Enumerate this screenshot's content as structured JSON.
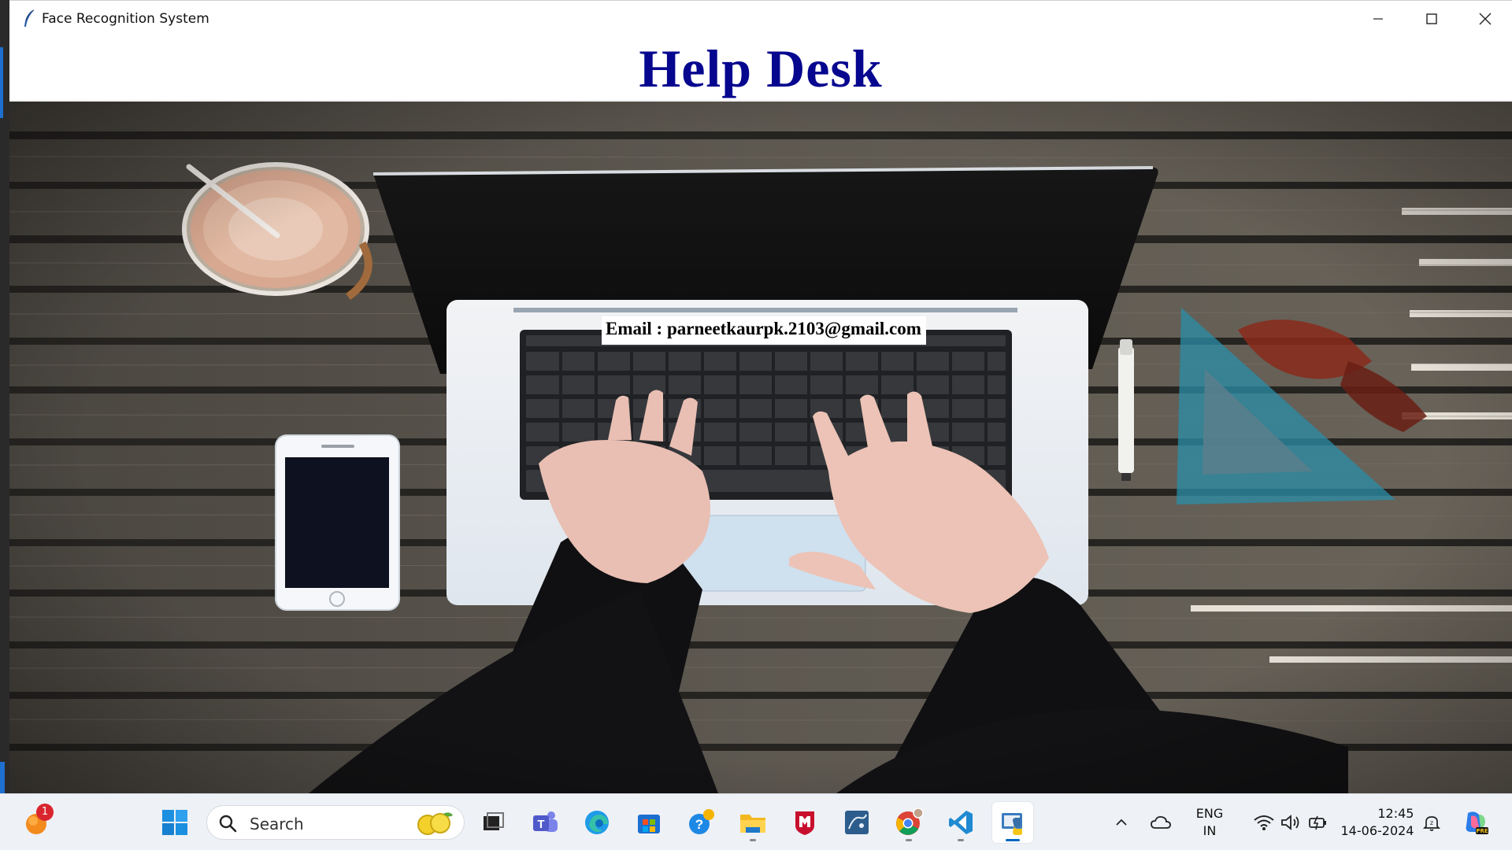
{
  "window": {
    "title": "Face Recognition System",
    "controls": {
      "minimize": "minimize",
      "maximize": "maximize",
      "close": "close"
    }
  },
  "page": {
    "heading": "Help Desk",
    "email_text": "Email : parneetkaurpk.2103@gmail.com"
  },
  "colors": {
    "heading": "#06068f",
    "taskbar_bg": "#eef1f6",
    "accent": "#0067c0"
  },
  "taskbar": {
    "notification_badge": "1",
    "search_placeholder": "Search",
    "apps": [
      {
        "name": "start",
        "icon": "windows-logo-icon"
      },
      {
        "name": "task-view",
        "icon": "task-view-icon"
      },
      {
        "name": "teams",
        "icon": "teams-icon"
      },
      {
        "name": "edge",
        "icon": "edge-icon"
      },
      {
        "name": "store",
        "icon": "store-icon"
      },
      {
        "name": "get-help",
        "icon": "help-icon"
      },
      {
        "name": "file-explorer",
        "icon": "folder-icon"
      },
      {
        "name": "mcafee",
        "icon": "mcafee-icon"
      },
      {
        "name": "mysql-workbench",
        "icon": "workbench-icon"
      },
      {
        "name": "chrome",
        "icon": "chrome-icon"
      },
      {
        "name": "vscode",
        "icon": "vscode-icon"
      },
      {
        "name": "python-app",
        "icon": "python-icon"
      }
    ],
    "tray": {
      "language_top": "ENG",
      "language_bottom": "IN",
      "time": "12:45",
      "date": "14-06-2024"
    }
  }
}
